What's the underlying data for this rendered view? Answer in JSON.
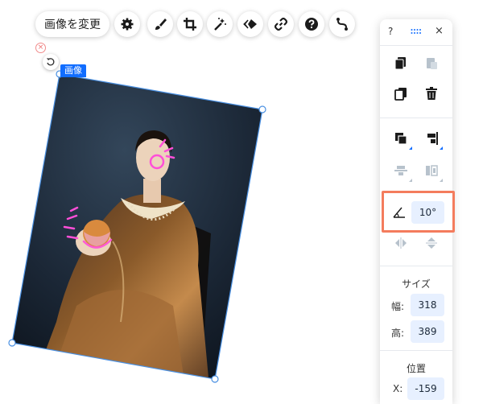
{
  "toolbar": {
    "change_image_label": "画像を変更",
    "buttons": [
      {
        "icon": "gear-icon"
      },
      {
        "icon": "brush-icon"
      },
      {
        "icon": "crop-icon"
      },
      {
        "icon": "magic-wand-icon"
      },
      {
        "icon": "animation-icon"
      },
      {
        "icon": "link-icon"
      },
      {
        "icon": "help-icon"
      },
      {
        "icon": "path-icon"
      }
    ]
  },
  "selection": {
    "element_tag": "画像",
    "rotation_deg": 10
  },
  "panel": {
    "help_label": "?",
    "close_label": "×",
    "rotation_value": "10°",
    "size_title": "サイズ",
    "width_label": "幅:",
    "width_value": "318",
    "height_label": "高:",
    "height_value": "389",
    "position_title": "位置",
    "x_label": "X:",
    "x_value": "-159"
  },
  "colors": {
    "accent": "#116dff",
    "highlight_border": "#f47c5d",
    "field_bg": "#e7f0ff",
    "neon_pink": "#ff4fd8"
  }
}
